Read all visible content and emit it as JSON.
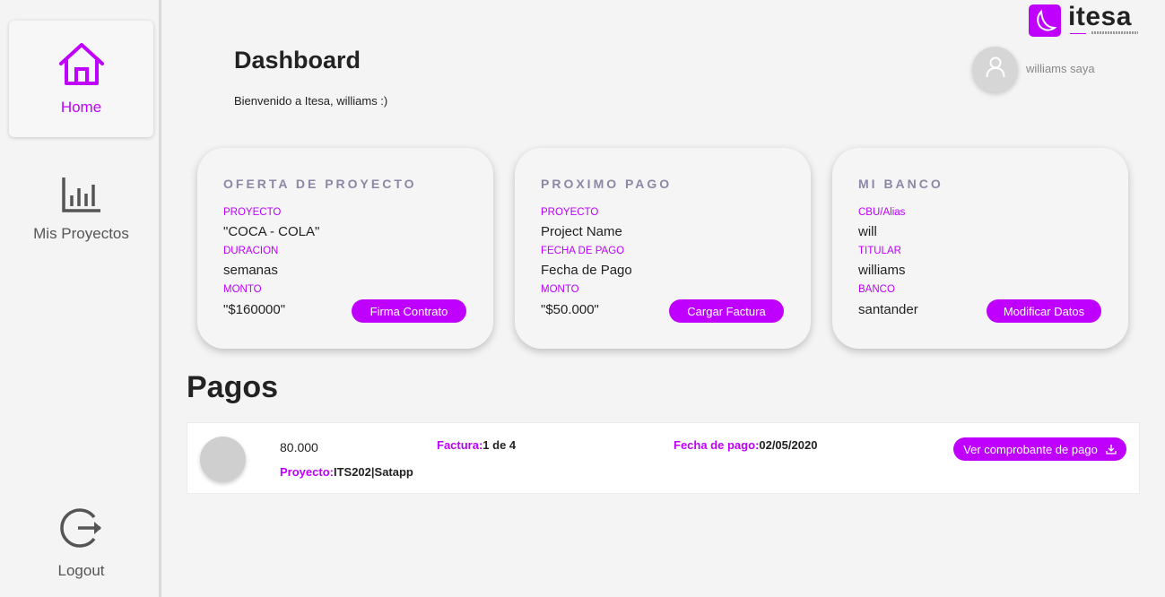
{
  "brand": {
    "name": "itesa",
    "accent_color": "#bf00ff"
  },
  "sidebar": {
    "items": [
      {
        "label": "Home",
        "icon": "home-icon",
        "active": true
      },
      {
        "label": "Mis Proyectos",
        "icon": "bar-chart-icon",
        "active": false
      }
    ],
    "logout": {
      "label": "Logout",
      "icon": "logout-icon"
    }
  },
  "header": {
    "title": "Dashboard",
    "welcome": "Bienvenido a Itesa, williams :)",
    "user_name": "williams saya"
  },
  "cards": [
    {
      "title": "OFERTA DE PROYECTO",
      "fields": [
        {
          "label": "PROYECTO",
          "value": "\"COCA - COLA\""
        },
        {
          "label": "DURACION",
          "value": "semanas"
        },
        {
          "label": "MONTO",
          "value": "\"$160000\""
        }
      ],
      "button": "Firma Contrato"
    },
    {
      "title": "PROXIMO PAGO",
      "fields": [
        {
          "label": "PROYECTO",
          "value": "Project Name"
        },
        {
          "label": "FECHA DE PAGO",
          "value": "Fecha de Pago"
        },
        {
          "label": "MONTO",
          "value": "\"$50.000\""
        }
      ],
      "button": "Cargar Factura"
    },
    {
      "title": "MI BANCO",
      "fields": [
        {
          "label": "CBU/Alias",
          "value": "will"
        },
        {
          "label": "TITULAR",
          "value": "williams"
        },
        {
          "label": "BANCO",
          "value": "santander"
        }
      ],
      "button": "Modificar Datos"
    }
  ],
  "pagos": {
    "title": "Pagos",
    "rows": [
      {
        "amount": "80.000",
        "project_label": "Proyecto:",
        "project_value": "ITS202|Satapp",
        "factura_label": "Factura:",
        "factura_value": "1 de 4",
        "fecha_label": "Fecha de pago:",
        "fecha_value": "02/05/2020",
        "button": "Ver comprobante de pago",
        "button_icon": "download-icon"
      }
    ]
  }
}
